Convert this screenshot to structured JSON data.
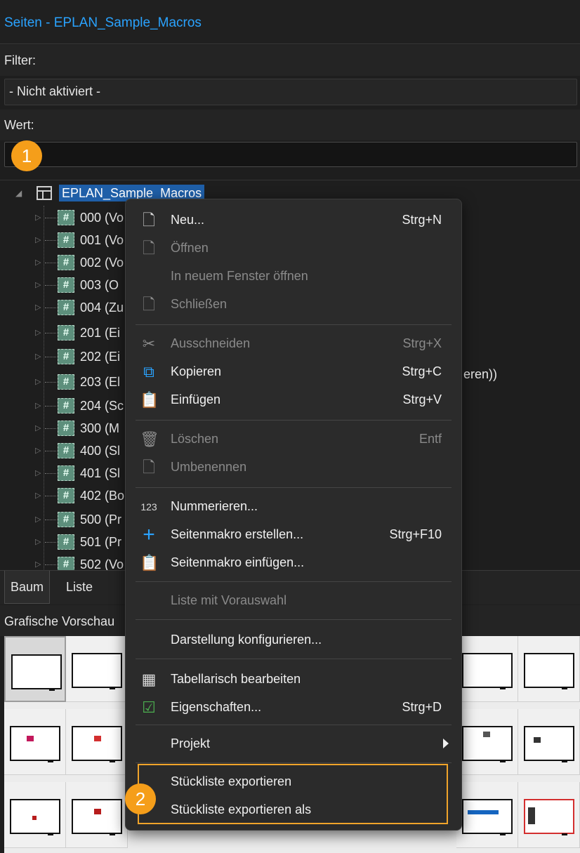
{
  "window": {
    "title": "Seiten - EPLAN_Sample_Macros"
  },
  "filter": {
    "label": "Filter:",
    "value": "- Nicht aktiviert -"
  },
  "wert": {
    "label": "Wert:",
    "value": ""
  },
  "tree": {
    "root": "EPLAN_Sample_Macros",
    "nodes": [
      "000 (Vo",
      "001 (Vo",
      "002 (Vo",
      "003 (O",
      "004 (Zu",
      "201 (Ei",
      "202 (Ei",
      "203 (El",
      "204 (Sc",
      "300 (M",
      "400 (Sl",
      "401 (Sl",
      "402 (Bo",
      "500 (Pr",
      "501 (Pr",
      "502 (Vo"
    ],
    "partial_text": "eren))"
  },
  "tabs": [
    "Baum",
    "Liste"
  ],
  "preview": {
    "title": "Grafische Vorschau"
  },
  "menu": {
    "items": [
      {
        "label": "Neu...",
        "shortcut": "Strg+N",
        "icon": "new-page-icon"
      },
      {
        "label": "Öffnen",
        "shortcut": "",
        "icon": "open-page-icon"
      },
      {
        "label": "In neuem Fenster öffnen",
        "shortcut": ""
      },
      {
        "label": "Schließen",
        "shortcut": "",
        "icon": "close-page-icon"
      },
      {
        "label": "Ausschneiden",
        "shortcut": "Strg+X",
        "icon": "scissors-icon"
      },
      {
        "label": "Kopieren",
        "shortcut": "Strg+C",
        "icon": "copy-icon"
      },
      {
        "label": "Einfügen",
        "shortcut": "Strg+V",
        "icon": "paste-icon"
      },
      {
        "label": "Löschen",
        "shortcut": "Entf",
        "icon": "trash-icon"
      },
      {
        "label": "Umbenennen",
        "shortcut": "",
        "icon": "rename-icon"
      },
      {
        "label": "Nummerieren...",
        "shortcut": "",
        "icon": "numbering-icon"
      },
      {
        "label": "Seitenmakro erstellen...",
        "shortcut": "Strg+F10",
        "icon": "plus-icon"
      },
      {
        "label": "Seitenmakro einfügen...",
        "shortcut": "",
        "icon": "insert-macro-icon"
      },
      {
        "label": "Liste mit Vorauswahl",
        "shortcut": ""
      },
      {
        "label": "Darstellung konfigurieren...",
        "shortcut": ""
      },
      {
        "label": "Tabellarisch bearbeiten",
        "shortcut": "",
        "icon": "table-icon"
      },
      {
        "label": "Eigenschaften...",
        "shortcut": "Strg+D",
        "icon": "properties-icon"
      },
      {
        "label": "Projekt",
        "shortcut": ""
      },
      {
        "label": "Stückliste exportieren",
        "shortcut": ""
      },
      {
        "label": "Stückliste exportieren als",
        "shortcut": ""
      }
    ]
  },
  "annotations": {
    "badge1": "1",
    "badge2": "2"
  },
  "colors": {
    "accent": "#2aa3ff",
    "badge": "#f59e1a",
    "selection": "#1f5fa8"
  }
}
